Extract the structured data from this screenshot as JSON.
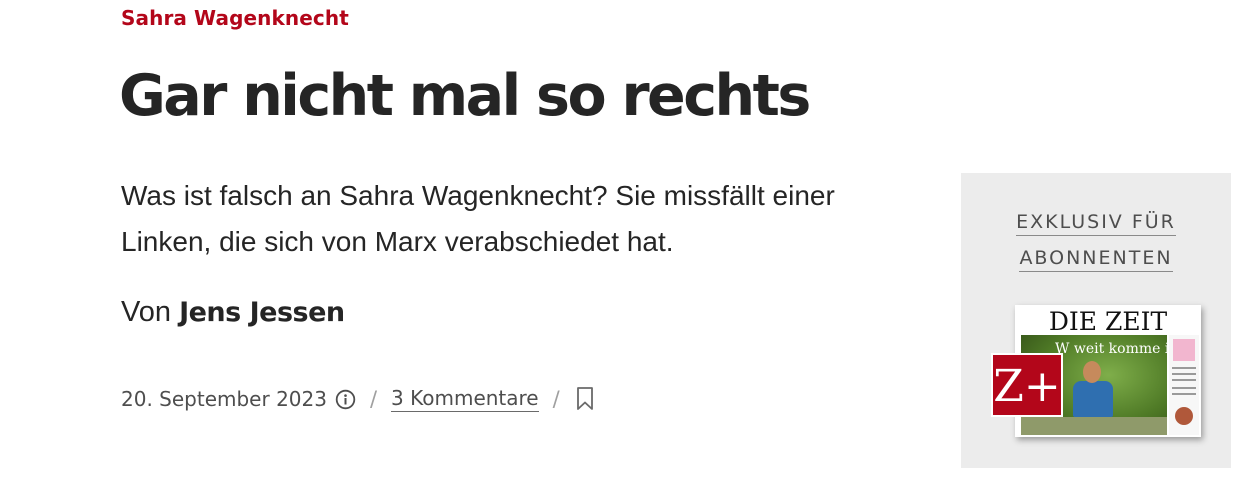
{
  "article": {
    "kicker": "Sahra Wagenknecht",
    "headline": "Gar nicht mal so rechts",
    "summary": "Was ist falsch an Sahra Wagenknecht? Sie missfällt einer Linken, die sich von Marx verabschiedet hat.",
    "byline_prefix": "Von",
    "author": "Jens Jessen",
    "date": "20. September 2023",
    "separator": "/",
    "comments": "3 Kommentare"
  },
  "promo": {
    "label_line1": "EXKLUSIV FÜR",
    "label_line2": "ABONNENTEN",
    "cover_title": "DIE ZEIT",
    "cover_headline": "W  weit komme ich?",
    "badge": "Z+"
  },
  "colors": {
    "accent": "#b3061a",
    "text": "#252525",
    "promo_bg": "#ececec"
  },
  "icons": {
    "info": "info-circle-icon",
    "bookmark": "bookmark-icon"
  }
}
